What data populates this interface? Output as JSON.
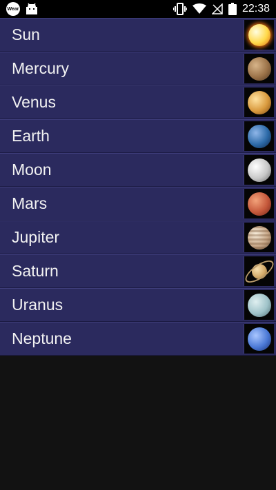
{
  "status_bar": {
    "wear_badge": "Wear",
    "time": "22:38"
  },
  "planets": [
    {
      "name": "Sun",
      "icon": "sun-icon",
      "colors": [
        "#fffde0",
        "#ffd94a",
        "#e06a10"
      ]
    },
    {
      "name": "Mercury",
      "icon": "mercury-icon",
      "colors": [
        "#d7b489",
        "#9b7248",
        "#4f3620"
      ]
    },
    {
      "name": "Venus",
      "icon": "venus-icon",
      "colors": [
        "#ffe2a0",
        "#d99a3e",
        "#7a4814"
      ]
    },
    {
      "name": "Earth",
      "icon": "earth-icon",
      "colors": [
        "#8fb6e8",
        "#2c6aa8",
        "#0d2447"
      ]
    },
    {
      "name": "Moon",
      "icon": "moon-icon",
      "colors": [
        "#ffffff",
        "#c8c8c8",
        "#6a6a6a"
      ]
    },
    {
      "name": "Mars",
      "icon": "mars-icon",
      "colors": [
        "#f2a27a",
        "#c5583b",
        "#6e2418"
      ]
    },
    {
      "name": "Jupiter",
      "icon": "jupiter-icon",
      "colors": [
        "#f4ead8",
        "#c8a889",
        "#6c543e"
      ]
    },
    {
      "name": "Saturn",
      "icon": "saturn-icon",
      "colors": [
        "#f7e1b0",
        "#d3aa6a",
        "#7a5a2c"
      ]
    },
    {
      "name": "Uranus",
      "icon": "uranus-icon",
      "colors": [
        "#dfeff0",
        "#9fc3c9",
        "#4e6c72"
      ]
    },
    {
      "name": "Neptune",
      "icon": "neptune-icon",
      "colors": [
        "#a9c6ff",
        "#4b79d6",
        "#1a2f70"
      ]
    }
  ]
}
